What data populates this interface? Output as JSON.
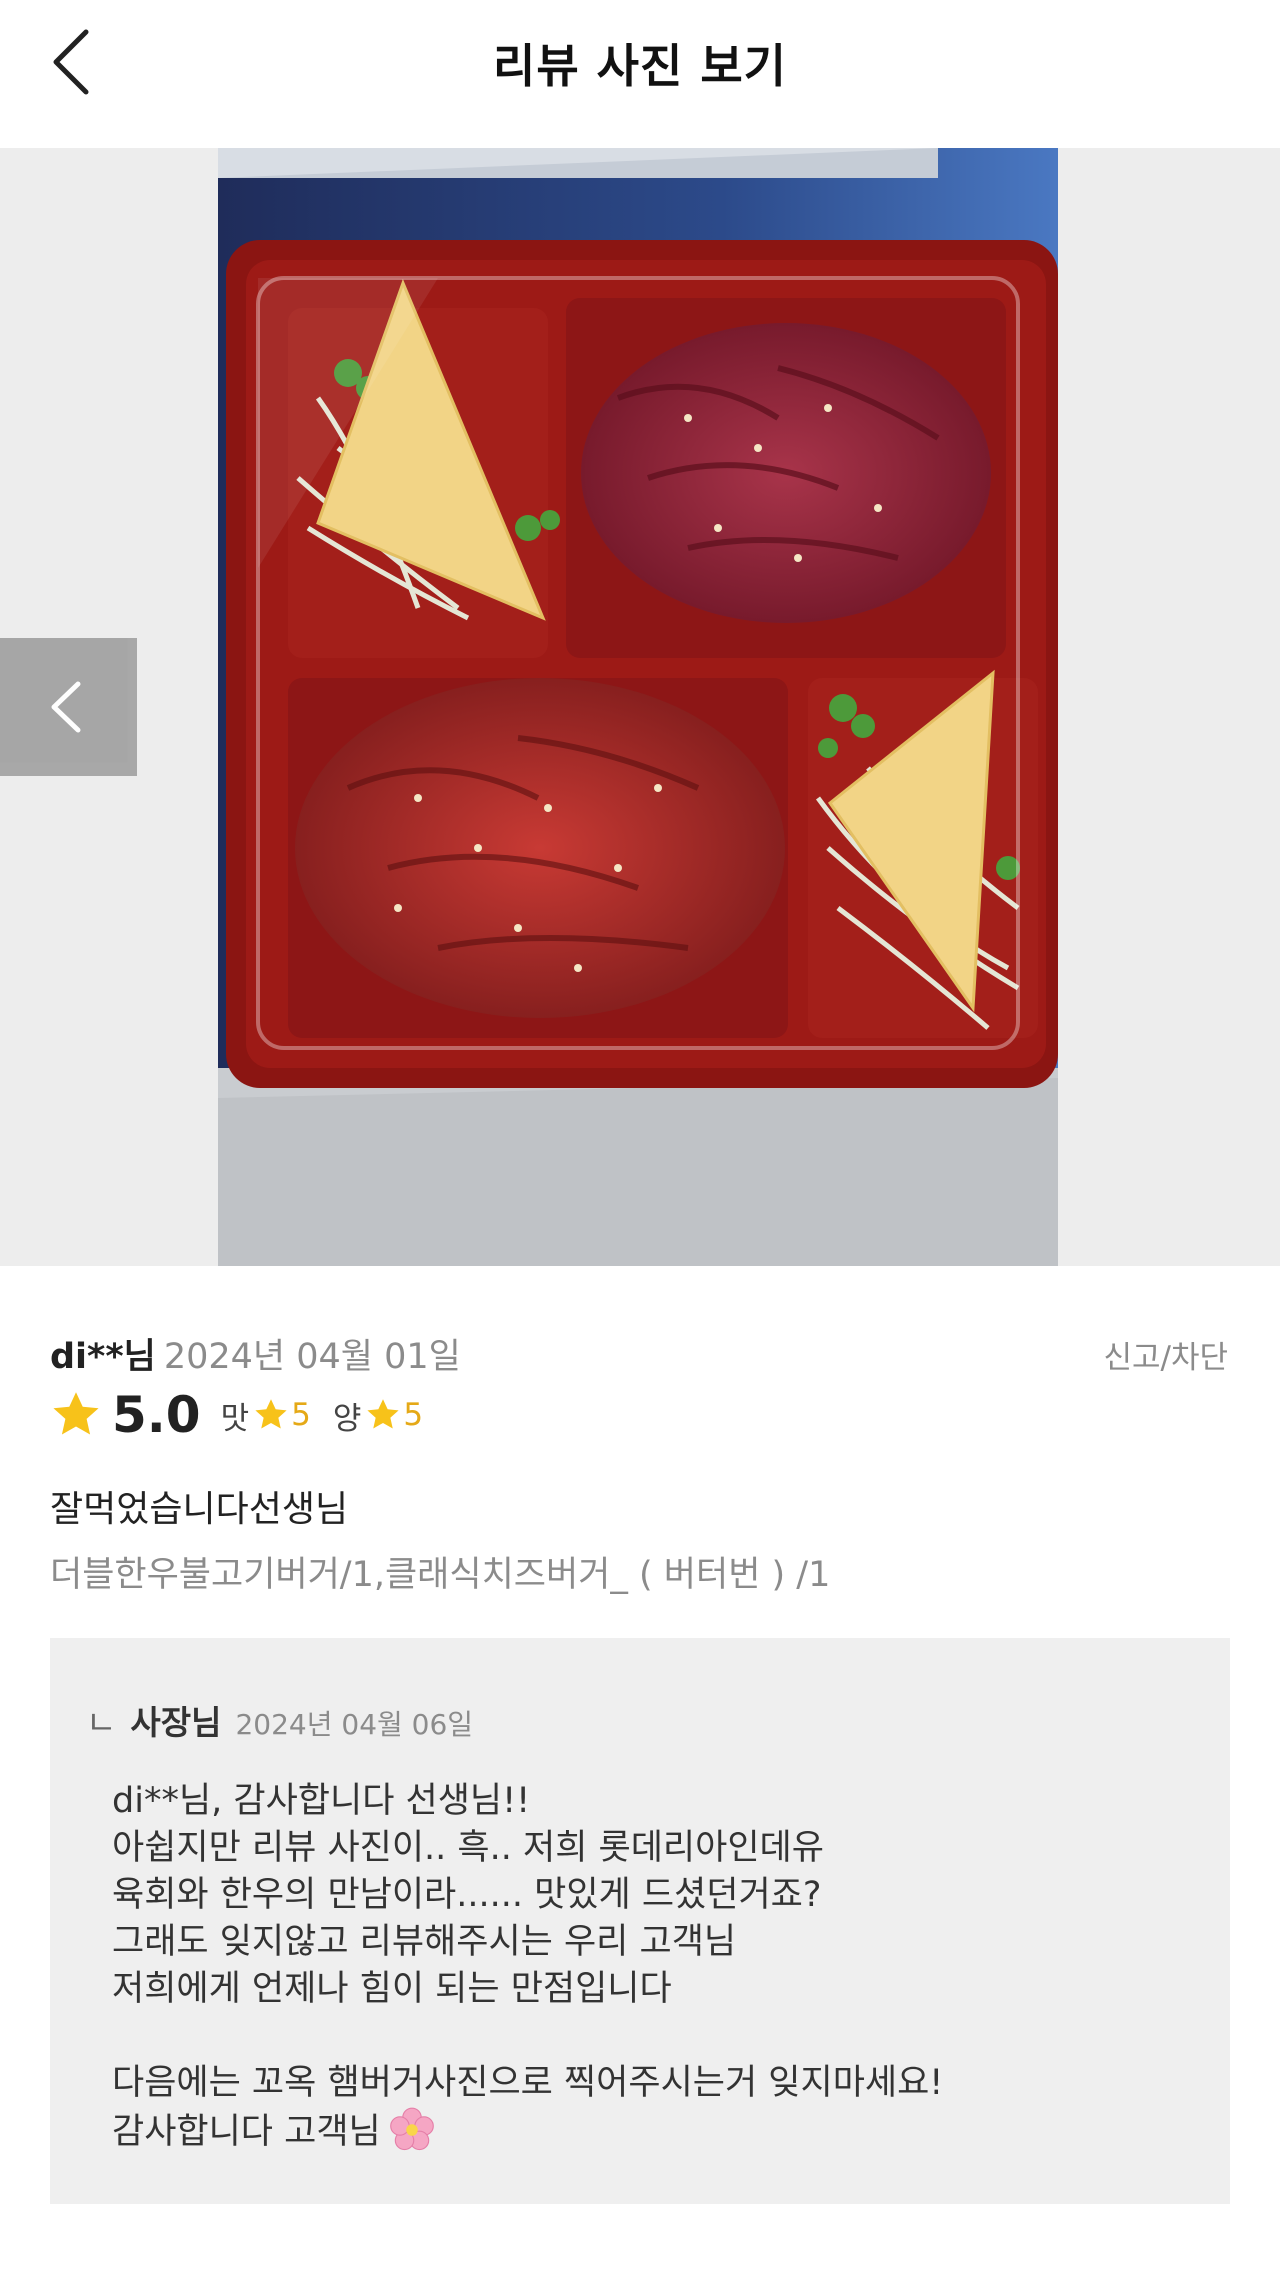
{
  "header": {
    "title": "리뷰 사진 보기"
  },
  "review": {
    "reviewer": "di**님",
    "date": "2024년 04월 01일",
    "report_label": "신고/차단",
    "score": "5.0",
    "taste_label": "맛",
    "taste_score": "5",
    "quantity_label": "양",
    "quantity_score": "5",
    "text": "잘먹었습니다선생님",
    "menu": "더블한우불고기버거/1,클래식치즈버거_ ( 버터번 ) /1"
  },
  "reply": {
    "mark": "ㄴ",
    "author": "사장님",
    "date": "2024년 04월 06일",
    "lines": [
      "di**님, 감사합니다 선생님!!",
      "아쉽지만 리뷰 사진이.. 흑.. 저희 롯데리아인데유",
      "육회와 한우의 만남이라...... 맛있게 드셨던거죠?",
      "그래도 잊지않고 리뷰해주시는 우리 고객님",
      "저희에게 언제나 힘이 되는 만점입니다",
      "다음에는 꼬옥 햄버거사진으로 찍어주시는거 잊지마세요!",
      "감사합니다 고객님"
    ]
  },
  "colors": {
    "star": "#f7c21a",
    "sub_score": "#e5a917",
    "muted": "#8b8b8b",
    "reply_bg": "#efefef"
  },
  "icons": {
    "back": "chevron-left-icon",
    "prev": "chevron-left-icon",
    "star": "star-icon",
    "emoji": "cherry-blossom-icon"
  }
}
